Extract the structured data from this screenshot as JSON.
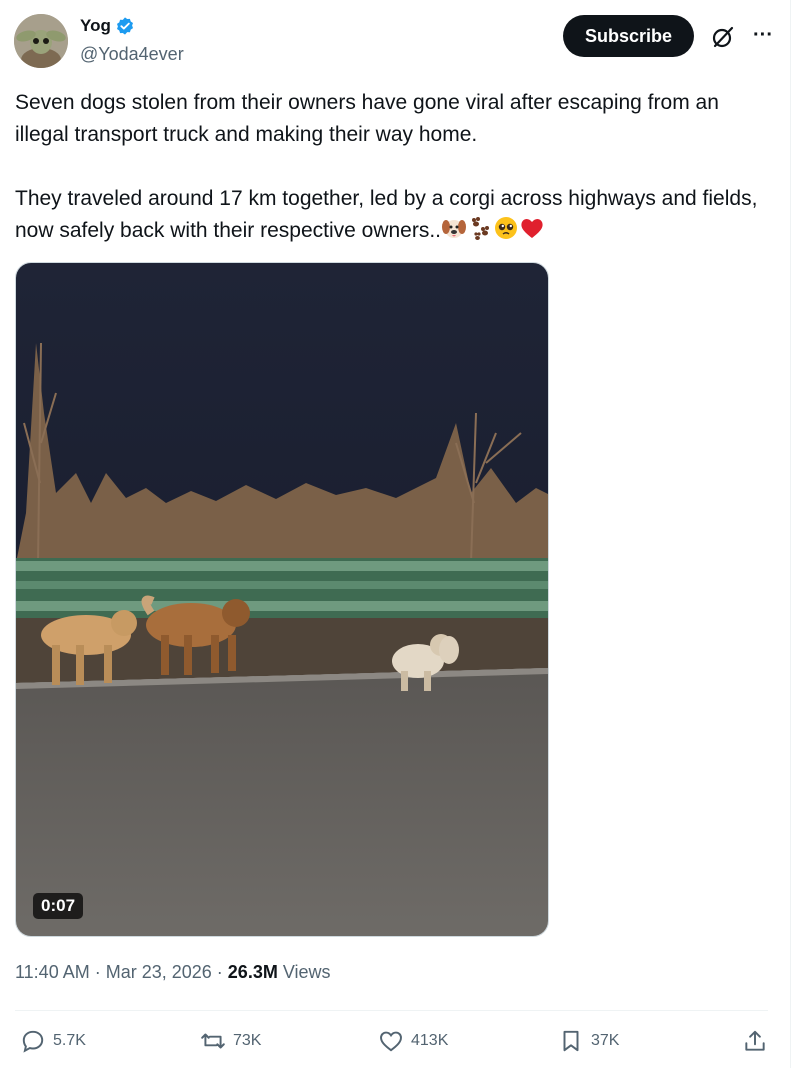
{
  "author": {
    "display_name": "Yog",
    "handle": "@Yoda4ever",
    "verified": true
  },
  "header": {
    "subscribe_label": "Subscribe",
    "grok_icon": "grok-icon",
    "more_icon": "more-icon"
  },
  "tweet": {
    "paragraph1": "Seven dogs stolen from their owners have gone viral after escaping from an illegal transport truck and making their way home.",
    "paragraph2": "They traveled around 17 km together, led by a corgi across highways and fields, now safely back with their respective owners..",
    "emojis": [
      "dog-face-emoji",
      "paw-prints-emoji",
      "pleading-face-emoji",
      "red-heart-emoji"
    ]
  },
  "media": {
    "type": "video",
    "duration": "0:07"
  },
  "meta": {
    "time": "11:40 AM",
    "separator": "·",
    "date": "Mar 23, 2026",
    "views_count": "26.3M",
    "views_label": "Views"
  },
  "actions": {
    "replies": "5.7K",
    "reposts": "73K",
    "likes": "413K",
    "bookmarks": "37K"
  },
  "colors": {
    "primary_text": "#0f1419",
    "secondary_text": "#536471",
    "verified_blue": "#1d9bf0",
    "subscribe_bg": "#0f1419"
  }
}
